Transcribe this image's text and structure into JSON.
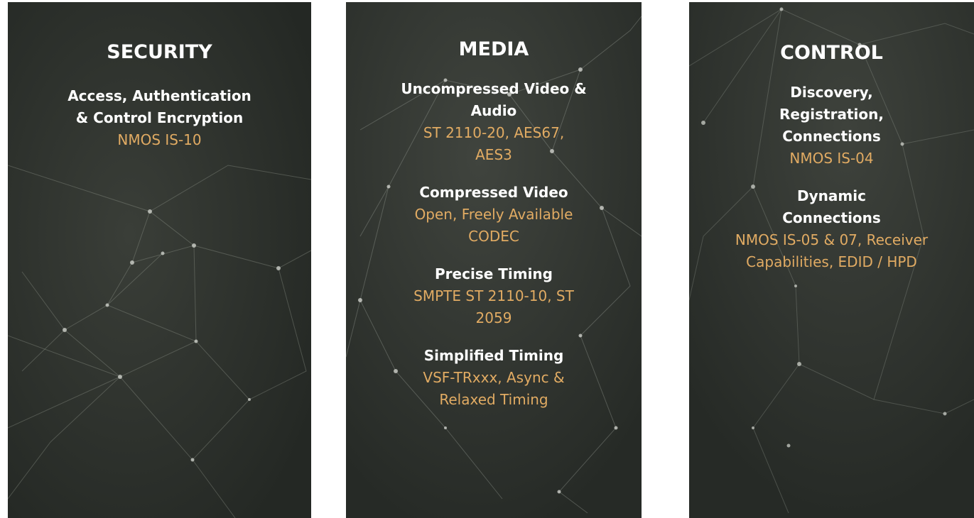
{
  "panels": [
    {
      "title": "SECURITY",
      "items": [
        {
          "title": "Access, Authentication & Control Encryption",
          "body": "NMOS IS-10"
        }
      ]
    },
    {
      "title": "MEDIA",
      "items": [
        {
          "title": "Uncompressed Video & Audio",
          "body": "ST 2110-20, AES67, AES3"
        },
        {
          "title": "Compressed Video",
          "body": "Open, Freely Available CODEC"
        },
        {
          "title": "Precise Timing",
          "body": "SMPTE ST 2110-10, ST 2059"
        },
        {
          "title": "Simplified Timing",
          "body": "VSF-TRxxx, Async & Relaxed Timing"
        }
      ]
    },
    {
      "title": "CONTROL",
      "items": [
        {
          "title": "Discovery, Registration, Connections",
          "body": "NMOS IS-04"
        },
        {
          "title": "Dynamic Connections",
          "body": "NMOS IS-05 & 07, Receiver Capabilities, EDID / HPD"
        }
      ]
    }
  ],
  "colors": {
    "panel_background": "#2a2e29",
    "title_text": "#ffffff",
    "accent_text": "#e1ab63"
  }
}
